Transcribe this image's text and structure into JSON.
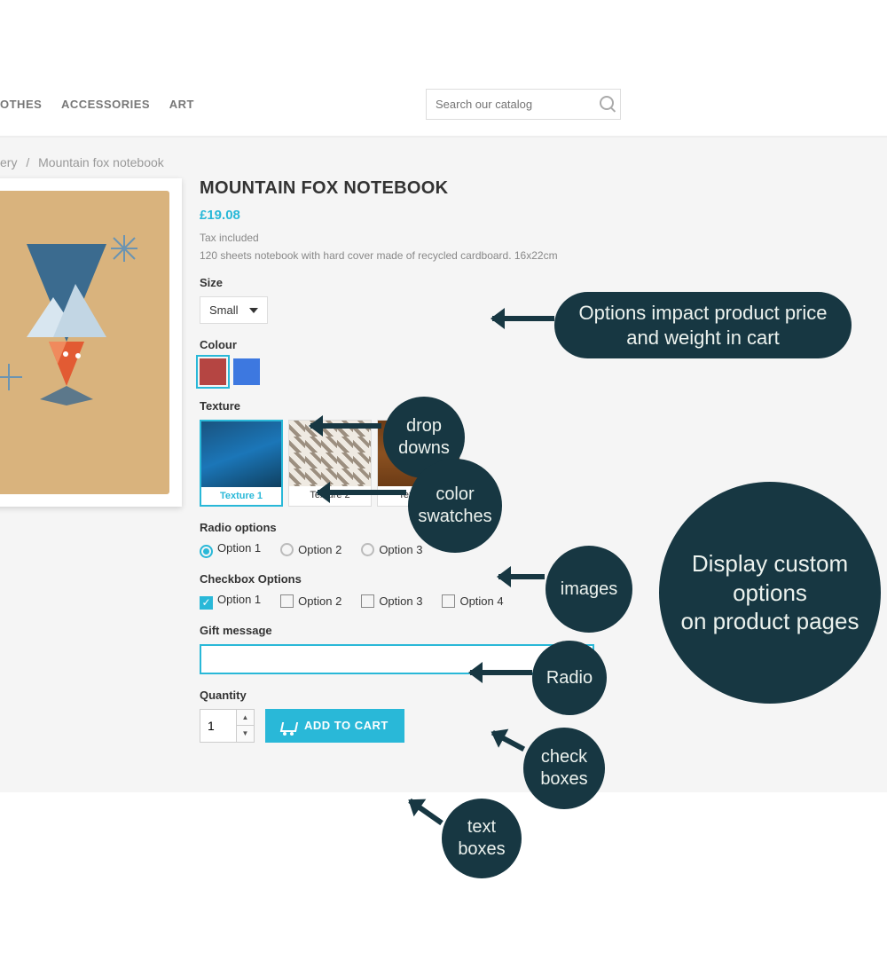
{
  "nav": {
    "clothes": "OTHES",
    "accessories": "ACCESSORIES",
    "art": "ART"
  },
  "search": {
    "placeholder": "Search our catalog"
  },
  "breadcrumb": {
    "cat": "ery",
    "sep": "/",
    "product": "Mountain fox notebook"
  },
  "title": "MOUNTAIN FOX NOTEBOOK",
  "price": "£19.08",
  "tax": "Tax included",
  "desc": "120 sheets notebook with hard cover made of recycled cardboard. 16x22cm",
  "sizeLabel": "Size",
  "sizeValue": "Small",
  "colourLabel": "Colour",
  "textureLabel": "Texture",
  "textures": {
    "t1": "Texture 1",
    "t2": "Texture 2",
    "t3": "Texture 3"
  },
  "radioLabel": "Radio options",
  "radioOpts": {
    "o1": "Option 1",
    "o2": "Option 2",
    "o3": "Option 3"
  },
  "checkLabel": "Checkbox Options",
  "checkOpts": {
    "o1": "Option 1",
    "o2": "Option 2",
    "o3": "Option 3",
    "o4": "Option 4"
  },
  "giftLabel": "Gift message",
  "qtyLabel": "Quantity",
  "qtyValue": "1",
  "addToCart": "ADD TO CART",
  "anno": {
    "dropdowns": "drop\ndowns",
    "swatches": "color\nswatches",
    "images": "images",
    "radio": "Radio",
    "checkboxes": "check\nboxes",
    "textboxes": "text\nboxes",
    "priceImpact": "Options impact product price\nand weight in cart",
    "display": "Display custom\noptions\non product pages"
  }
}
